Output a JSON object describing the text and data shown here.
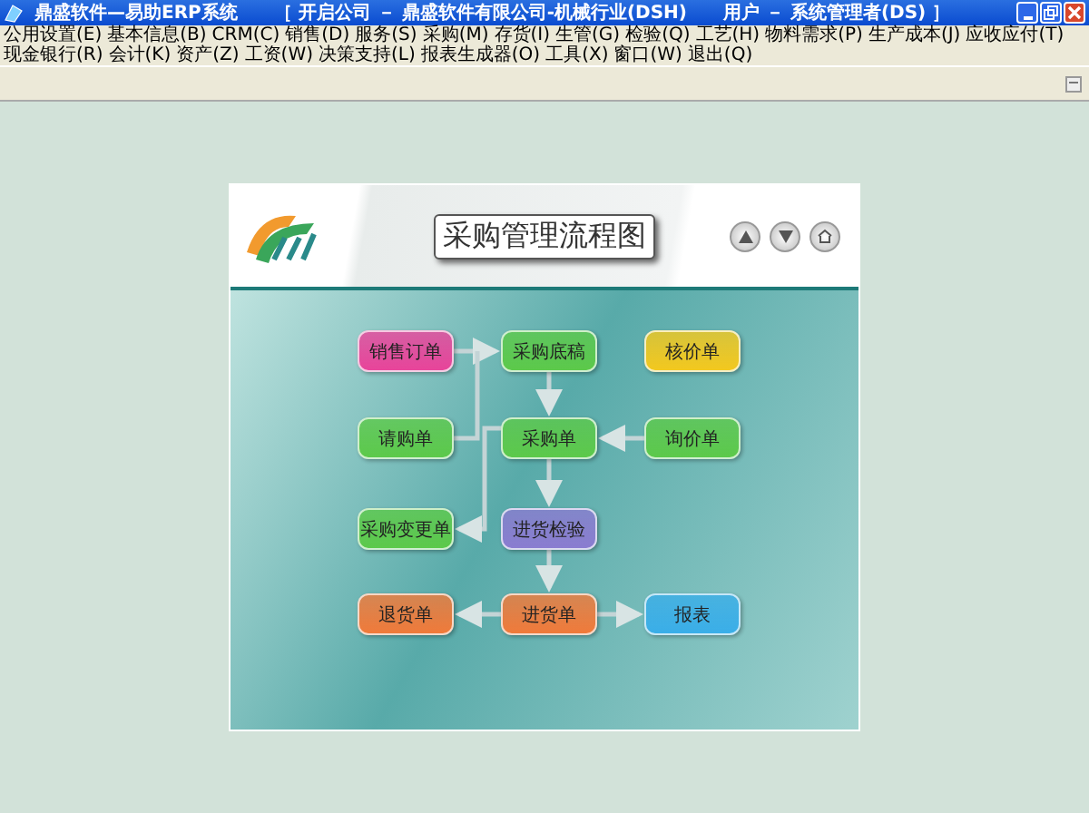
{
  "window": {
    "title": "鼎盛软件—易助ERP系统",
    "context": "［ 开启公司 － 鼎盛软件有限公司-机械行业(DSH)　　用户 － 系统管理者(DS) ］"
  },
  "menu": [
    {
      "label": "公用设置(E)"
    },
    {
      "label": "基本信息(B)"
    },
    {
      "label": "CRM(C)"
    },
    {
      "label": "销售(D)"
    },
    {
      "label": "服务(S)"
    },
    {
      "label": "采购(M)"
    },
    {
      "label": "存货(I)"
    },
    {
      "label": "生管(G)"
    },
    {
      "label": "检验(Q)"
    },
    {
      "label": "工艺(H)"
    },
    {
      "label": "物料需求(P)"
    },
    {
      "label": "生产成本(J)"
    },
    {
      "label": "应收应付(T)"
    },
    {
      "label": "现金银行(R)"
    },
    {
      "label": "会计(K)"
    },
    {
      "label": "资产(Z)"
    },
    {
      "label": "工资(W)"
    },
    {
      "label": "决策支持(L)"
    },
    {
      "label": "报表生成器(O)"
    },
    {
      "label": "工具(X)"
    },
    {
      "label": "窗口(W)"
    },
    {
      "label": "退出(Q)"
    }
  ],
  "panel": {
    "title": "采购管理流程图",
    "nodes": [
      {
        "label": "销售订单",
        "color": "#e8449a"
      },
      {
        "label": "采购底稿",
        "color": "#5cc94a"
      },
      {
        "label": "核价单",
        "color": "#f3c81e"
      },
      {
        "label": "请购单",
        "color": "#5cc94a"
      },
      {
        "label": "采购单",
        "color": "#5cc94a"
      },
      {
        "label": "询价单",
        "color": "#5cc94a"
      },
      {
        "label": "采购变更单",
        "color": "#5cc94a"
      },
      {
        "label": "进货检验",
        "color": "#8a7cd0"
      },
      {
        "label": "退货单",
        "color": "#f07a3a"
      },
      {
        "label": "进货单",
        "color": "#f07a3a"
      },
      {
        "label": "报表",
        "color": "#3aaee8"
      }
    ]
  }
}
